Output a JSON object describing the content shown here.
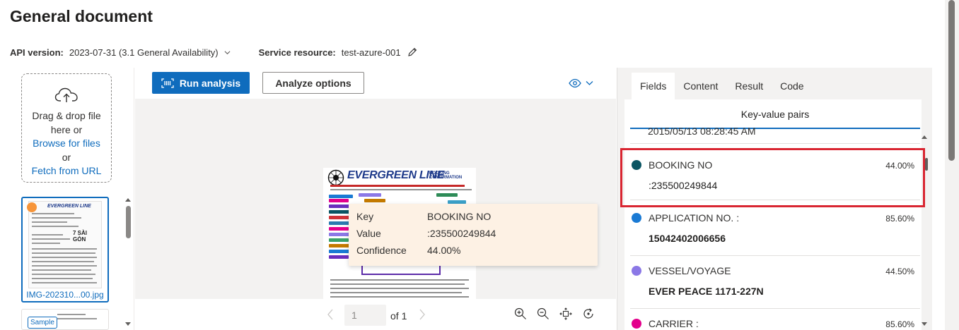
{
  "page": {
    "title": "General document"
  },
  "meta": {
    "api_version_label": "API version:",
    "api_version_value": "2023-07-31 (3.1 General Availability)",
    "service_resource_label": "Service resource:",
    "service_resource_value": "test-azure-001"
  },
  "upload": {
    "drag_line1": "Drag & drop file",
    "drag_line2": "here or",
    "browse_link": "Browse for files",
    "or_text": "or",
    "fetch_link": "Fetch from URL"
  },
  "thumbnails": [
    {
      "name": "IMG-202310...00.jpg",
      "selected": true
    },
    {
      "badge": "Sample",
      "selected": false
    }
  ],
  "toolbar": {
    "run_label": "Run analysis",
    "options_label": "Analyze options"
  },
  "document": {
    "title_text": "EVERGREEN LINE",
    "subtitle_line1": "BOOKING",
    "subtitle_line2": "CONFIRMATION"
  },
  "tooltip": {
    "key_label": "Key",
    "key_value": "BOOKING NO",
    "value_label": "Value",
    "value_value": ":235500249844",
    "confidence_label": "Confidence",
    "confidence_value": "44.00%"
  },
  "pager": {
    "page_input": "1",
    "of_text": "of 1"
  },
  "tabs": [
    {
      "label": "Fields",
      "active": true
    },
    {
      "label": "Content",
      "active": false
    },
    {
      "label": "Result",
      "active": false
    },
    {
      "label": "Code",
      "active": false
    }
  ],
  "fields_panel": {
    "header": "Key-value pairs",
    "cut_value": "2015/05/13 08:28:45 AM",
    "fields": [
      {
        "name": "BOOKING NO",
        "confidence": "44.00%",
        "value": ":235500249844",
        "color": "#0b5563"
      },
      {
        "name": "APPLICATION NO. :",
        "confidence": "85.60%",
        "value": "15042402006656",
        "color": "#1a7ad4"
      },
      {
        "name": "VESSEL/VOYAGE",
        "confidence": "44.50%",
        "value": "EVER PEACE 1171-227N",
        "color": "#8b78e6"
      },
      {
        "name": "CARRIER :",
        "confidence": "85.60%",
        "value": "",
        "color": "#e3008c"
      }
    ]
  },
  "colors": {
    "accent": "#0f6cbd",
    "highlight_border": "#d92531",
    "tooltip_bg": "#fdf1e4"
  }
}
